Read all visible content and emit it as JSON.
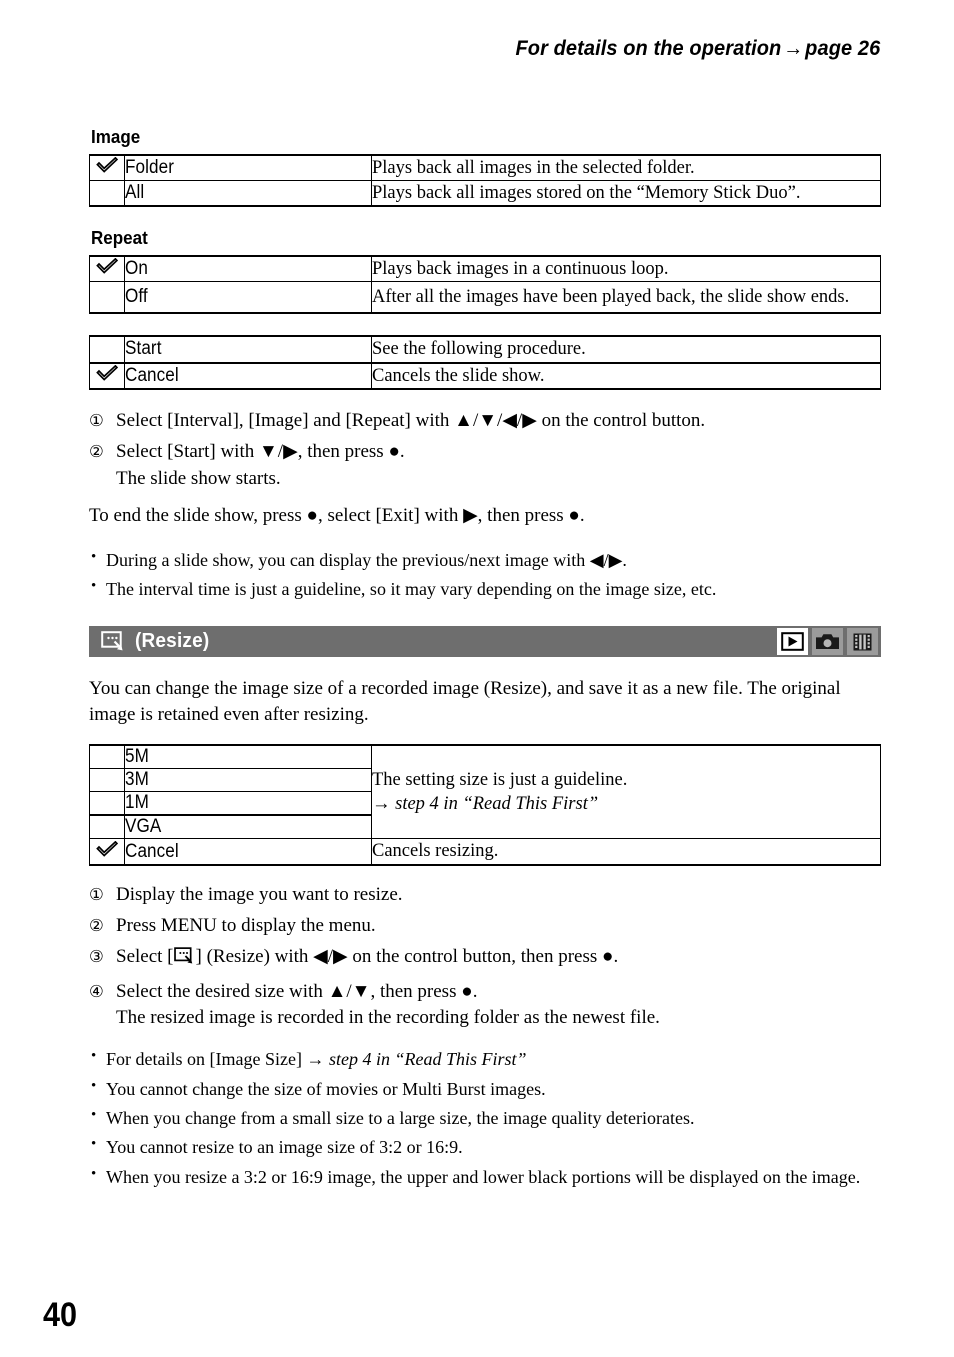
{
  "header": {
    "running_head_prefix": "For details on the operation",
    "running_head_arrow": "→",
    "running_head_page": "page 26"
  },
  "page_number": "40",
  "sections": {
    "image": {
      "heading": "Image",
      "rows": [
        {
          "checked": true,
          "name": "Folder",
          "desc": "Plays back all images in the selected folder."
        },
        {
          "checked": false,
          "name": "All",
          "desc": "Plays back all images stored on the “Memory Stick Duo”."
        }
      ]
    },
    "repeat": {
      "heading": "Repeat",
      "rows": [
        {
          "checked": true,
          "name": "On",
          "desc": "Plays back images in a continuous loop."
        },
        {
          "checked": false,
          "name": "Off",
          "desc": "After all the images have been played back, the slide show ends."
        }
      ]
    },
    "startcancel": {
      "rows": [
        {
          "checked": false,
          "name": "Start",
          "desc": "See the following procedure."
        },
        {
          "checked": true,
          "name": "Cancel",
          "desc": "Cancels the slide show."
        }
      ]
    }
  },
  "slideshow_steps": [
    {
      "num": "①",
      "text": "Select [Interval], [Image] and [Repeat] with ▲/▼/◀/▶ on the control button.",
      "sub": ""
    },
    {
      "num": "②",
      "text": "Select [Start] with ▼/▶, then press ●.",
      "sub": "The slide show starts."
    }
  ],
  "slideshow_end_note": "To end the slide show, press ●, select [Exit] with ▶, then press ●.",
  "slideshow_notes": [
    "During a slide show, you can display the previous/next image with ◀/▶.",
    "The interval time is just a guideline, so it may vary depending on the image size, etc."
  ],
  "resize_section": {
    "bar_title": "(Resize)",
    "bar_icon": "resize-icon",
    "bar_color": "#6e6e6e",
    "mode_icons": [
      {
        "name": "playback-mode-icon",
        "active": true
      },
      {
        "name": "camera-mode-icon",
        "active": false
      },
      {
        "name": "movie-mode-icon",
        "active": false
      }
    ],
    "intro": "You can change the image size of a recorded image (Resize), and save it as a new file. The original image is retained even after resizing.",
    "size_rows": [
      {
        "checked": false,
        "name": "5M"
      },
      {
        "checked": false,
        "name": "3M"
      },
      {
        "checked": false,
        "name": "1M"
      },
      {
        "checked": false,
        "name": "VGA"
      }
    ],
    "size_desc_line1": "The setting size is just a guideline.",
    "size_desc_arrow": "→",
    "size_desc_line2": "step 4 in “Read This First”",
    "cancel_row": {
      "checked": true,
      "name": "Cancel",
      "desc": "Cancels resizing."
    },
    "steps": [
      {
        "num": "①",
        "text_before": "Display the image you want to resize.",
        "has_icon": false,
        "text_after": "",
        "sub": ""
      },
      {
        "num": "②",
        "text_before": "Press MENU to display the menu.",
        "has_icon": false,
        "text_after": "",
        "sub": ""
      },
      {
        "num": "③",
        "text_before": "Select [",
        "has_icon": true,
        "text_after": "] (Resize) with ◀/▶ on the control button, then press ●.",
        "sub": ""
      },
      {
        "num": "④",
        "text_before": "Select the desired size with ▲/▼, then press ●.",
        "has_icon": false,
        "text_after": "",
        "sub": "The resized image is recorded in the recording folder as the newest file."
      }
    ],
    "notes": [
      {
        "plain": "For details on [Image Size] ",
        "arrow": "→",
        "italic": " step 4 in “Read This First”"
      },
      {
        "plain": "You cannot change the size of movies or Multi Burst images.",
        "arrow": "",
        "italic": ""
      },
      {
        "plain": "When you change from a small size to a large size, the image quality deteriorates.",
        "arrow": "",
        "italic": ""
      },
      {
        "plain": "You cannot resize to an image size of 3:2 or 16:9.",
        "arrow": "",
        "italic": ""
      },
      {
        "plain": "When you resize a 3:2 or 16:9 image, the upper and lower black portions will be displayed on the image.",
        "arrow": "",
        "italic": ""
      }
    ]
  }
}
